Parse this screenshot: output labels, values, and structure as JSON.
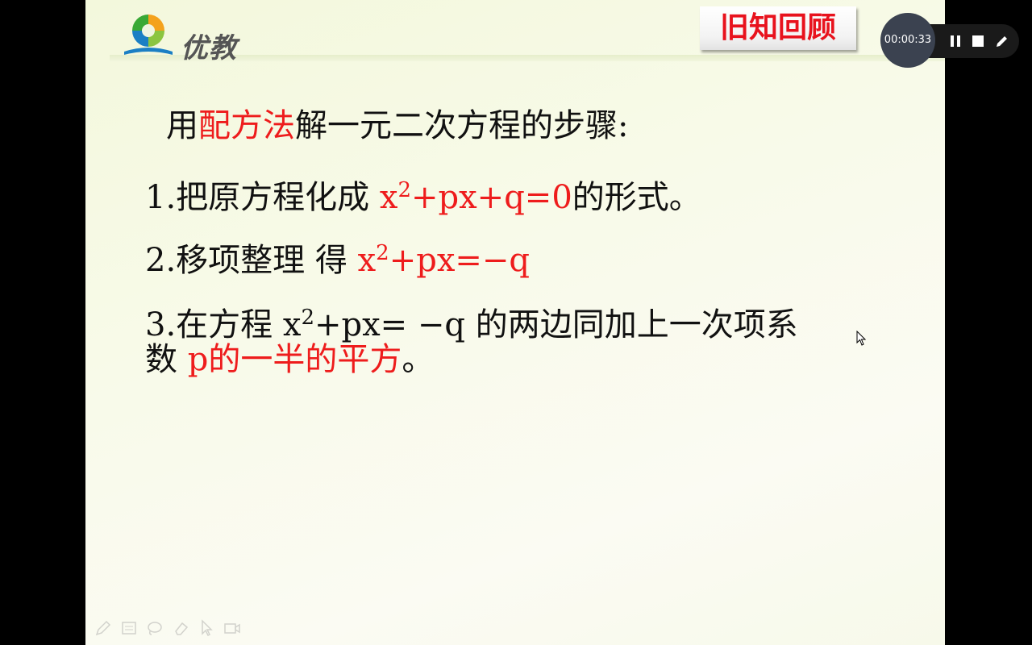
{
  "logo": {
    "brand": "优教",
    "icon": "youjiao-logo-icon"
  },
  "slide": {
    "section_tag": "旧知回顾",
    "heading": {
      "prefix": "用",
      "highlight": "配方法",
      "suffix": "解一元二次方程的步骤:"
    },
    "step1": {
      "number": "1.",
      "text": "把原方程化成 ",
      "formula_x": "x",
      "formula_sup": "2",
      "formula_rest": "+px+q=0",
      "suffix": "的形式。"
    },
    "step2": {
      "number": "2.",
      "text": "移项整理 得 ",
      "formula_x": "x",
      "formula_sup": "2",
      "formula_rest": "+px=−q"
    },
    "step3": {
      "number": "3.",
      "text": "在方程 ",
      "formula_x": "x",
      "formula_sup": "2",
      "formula_rest": "+px= −q",
      "suffix": " 的两边同加上一次项系",
      "line2_prefix": "数 ",
      "line2_highlight": "p的一半的平方",
      "line2_suffix": "。"
    }
  },
  "recorder": {
    "timer": "00:00:33",
    "pause_icon": "pause-icon",
    "stop_icon": "stop-icon",
    "pen_icon": "pen-icon"
  },
  "toolbar_icons": [
    "pencil-icon",
    "board-icon",
    "lasso-icon",
    "eraser-icon",
    "pointer-icon",
    "camera-icon"
  ],
  "colors": {
    "highlight": "#ee1c1c",
    "tag_text": "#e8121d",
    "text": "#111111"
  }
}
